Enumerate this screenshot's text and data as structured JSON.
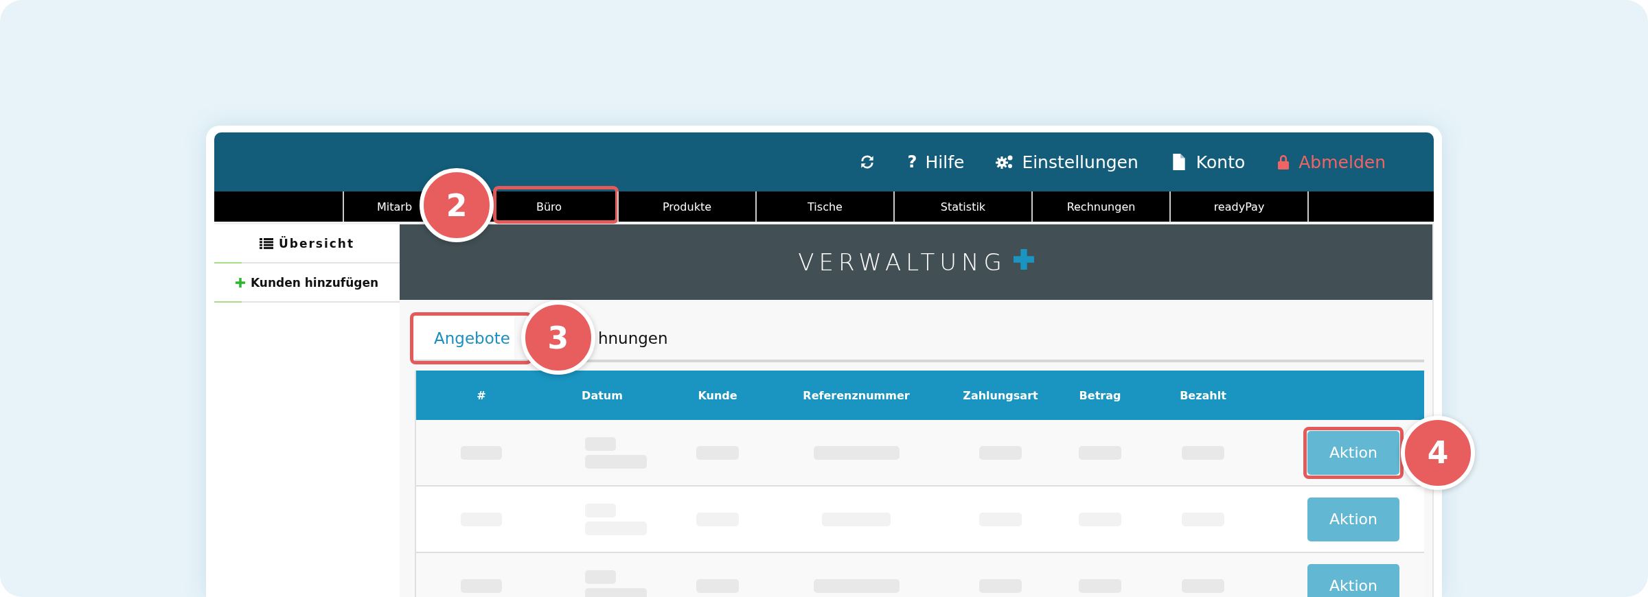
{
  "header": {
    "items": [
      {
        "kind": "normal"
      },
      {
        "glyph": "?",
        "label": "Hilfe",
        "kind": "normal"
      },
      {
        "label": "Einstellungen",
        "kind": "normal"
      },
      {
        "label": "Konto",
        "kind": "normal"
      },
      {
        "label": "Abmelden",
        "kind": "danger"
      }
    ]
  },
  "nav": {
    "items": [
      {
        "label": "Mitarb"
      },
      {
        "label": "Büro",
        "callout": "2"
      },
      {
        "label": "Produkte"
      },
      {
        "label": "Tische"
      },
      {
        "label": "Statistik"
      },
      {
        "label": "Rechnungen"
      },
      {
        "label": "readyPay"
      }
    ]
  },
  "sidebar": {
    "items": [
      {
        "label": "Übersicht"
      },
      {
        "label": "Kunden hinzufügen"
      }
    ]
  },
  "banner": {
    "title": "VERWALTUNG"
  },
  "tabs": [
    {
      "label": "Angebote",
      "selected": true,
      "callout": "3"
    },
    {
      "label": "hnungen",
      "selected": false
    }
  ],
  "table": {
    "columns": [
      "#",
      "Datum",
      "Kunde",
      "Referenznummer",
      "Zahlungsart",
      "Betrag",
      "Bezahlt"
    ],
    "rows": [
      {
        "button": "Aktion",
        "callout": "4"
      },
      {
        "button": "Aktion"
      },
      {
        "button": "Aktion"
      }
    ]
  }
}
